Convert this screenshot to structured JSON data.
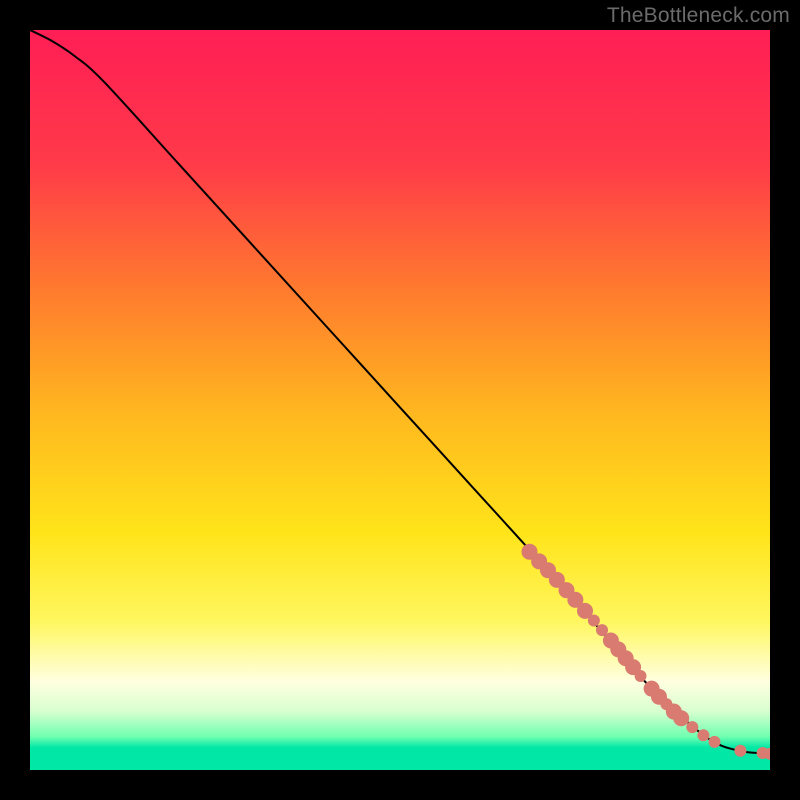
{
  "watermark": "TheBottleneck.com",
  "chart_data": {
    "type": "line",
    "title": "",
    "xlabel": "",
    "ylabel": "",
    "xlim": [
      0,
      100
    ],
    "ylim": [
      0,
      100
    ],
    "grid": false,
    "legend": false,
    "gradient_bands": [
      {
        "stop": 0.0,
        "color": "#ff1e55"
      },
      {
        "stop": 0.18,
        "color": "#ff3a49"
      },
      {
        "stop": 0.35,
        "color": "#ff7a2e"
      },
      {
        "stop": 0.52,
        "color": "#ffb81f"
      },
      {
        "stop": 0.68,
        "color": "#ffe41a"
      },
      {
        "stop": 0.8,
        "color": "#fff760"
      },
      {
        "stop": 0.88,
        "color": "#ffffe0"
      },
      {
        "stop": 0.92,
        "color": "#d9ffd0"
      },
      {
        "stop": 0.955,
        "color": "#6fffb0"
      },
      {
        "stop": 0.97,
        "color": "#00e7a6"
      },
      {
        "stop": 1.0,
        "color": "#00e7a6"
      }
    ],
    "series": [
      {
        "name": "curve",
        "color": "#000000",
        "x": [
          0,
          3,
          6,
          10,
          20,
          30,
          40,
          50,
          60,
          70,
          77,
          84,
          90,
          93,
          95,
          97,
          100
        ],
        "y": [
          100,
          98.5,
          96.5,
          93,
          82,
          71,
          60,
          49,
          38,
          27,
          19,
          11,
          5.5,
          3.5,
          2.8,
          2.4,
          2.2
        ]
      }
    ],
    "markers": {
      "color": "#d97b71",
      "radius_small": 6,
      "radius_large": 8,
      "points": [
        {
          "x": 67.5,
          "y": 29.5,
          "r": 8
        },
        {
          "x": 68.8,
          "y": 28.2,
          "r": 8
        },
        {
          "x": 70.0,
          "y": 27.0,
          "r": 8
        },
        {
          "x": 71.2,
          "y": 25.7,
          "r": 8
        },
        {
          "x": 72.5,
          "y": 24.3,
          "r": 8
        },
        {
          "x": 73.7,
          "y": 23.0,
          "r": 8
        },
        {
          "x": 75.0,
          "y": 21.5,
          "r": 8
        },
        {
          "x": 76.2,
          "y": 20.2,
          "r": 6
        },
        {
          "x": 77.3,
          "y": 18.9,
          "r": 6
        },
        {
          "x": 78.5,
          "y": 17.5,
          "r": 8
        },
        {
          "x": 79.5,
          "y": 16.3,
          "r": 8
        },
        {
          "x": 80.5,
          "y": 15.1,
          "r": 8
        },
        {
          "x": 81.5,
          "y": 13.9,
          "r": 8
        },
        {
          "x": 82.5,
          "y": 12.7,
          "r": 6
        },
        {
          "x": 84.0,
          "y": 11.0,
          "r": 8
        },
        {
          "x": 85.0,
          "y": 9.9,
          "r": 8
        },
        {
          "x": 86.0,
          "y": 8.9,
          "r": 6
        },
        {
          "x": 87.0,
          "y": 7.9,
          "r": 8
        },
        {
          "x": 88.0,
          "y": 7.0,
          "r": 8
        },
        {
          "x": 89.5,
          "y": 5.8,
          "r": 6
        },
        {
          "x": 91.0,
          "y": 4.7,
          "r": 6
        },
        {
          "x": 92.5,
          "y": 3.8,
          "r": 6
        },
        {
          "x": 96.0,
          "y": 2.6,
          "r": 6
        },
        {
          "x": 99.0,
          "y": 2.3,
          "r": 6
        },
        {
          "x": 100.0,
          "y": 2.2,
          "r": 6
        }
      ]
    }
  }
}
